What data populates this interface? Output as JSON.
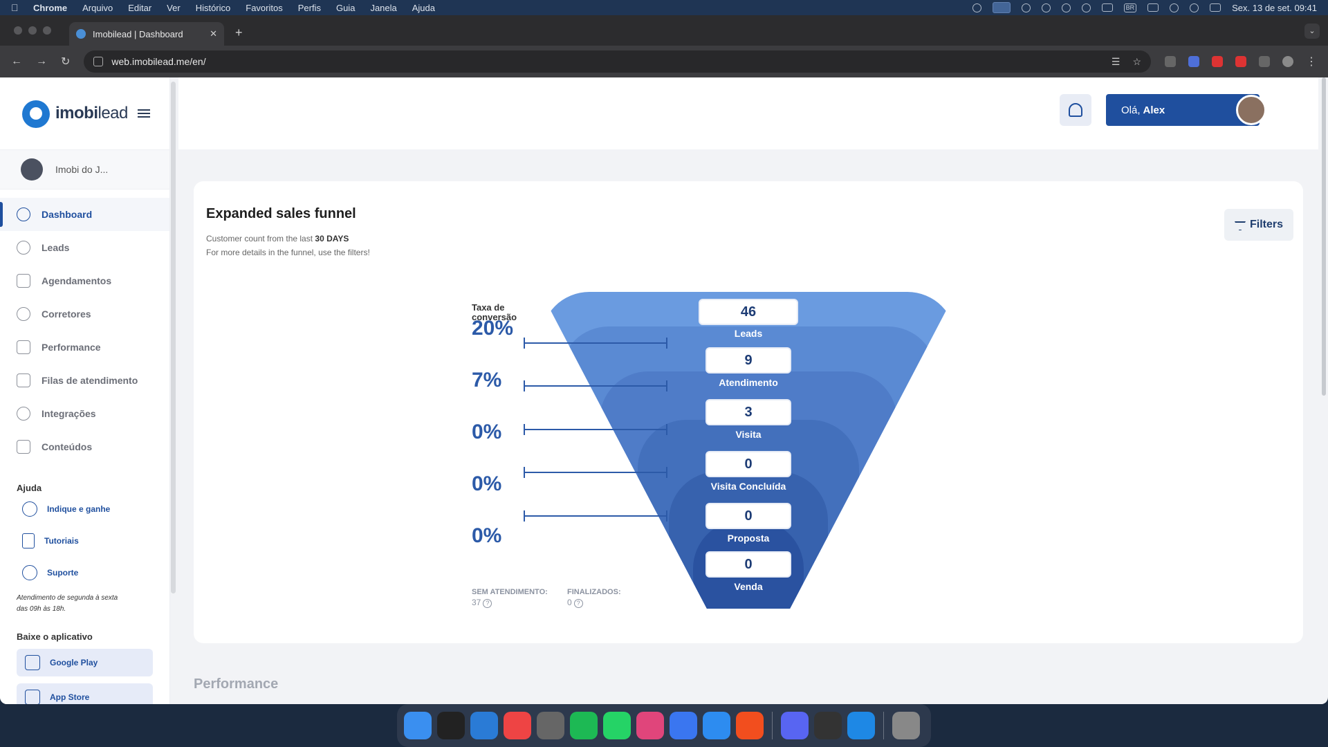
{
  "menubar": {
    "items": [
      "Chrome",
      "Arquivo",
      "Editar",
      "Ver",
      "Histórico",
      "Favoritos",
      "Perfis",
      "Guia",
      "Janela",
      "Ajuda"
    ],
    "keyboard_indicator": "BR",
    "clock": "Sex. 13 de set.  09:41"
  },
  "browser": {
    "tab_title": "Imobilead | Dashboard",
    "url": "web.imobilead.me/en/"
  },
  "sidebar": {
    "logo_bold": "imobi",
    "logo_light": "lead",
    "org_name": "Imobi do J...",
    "nav": [
      {
        "label": "Dashboard",
        "icon": "dashboard-icon",
        "active": true
      },
      {
        "label": "Leads",
        "icon": "user-icon"
      },
      {
        "label": "Agendamentos",
        "icon": "calendar-icon"
      },
      {
        "label": "Corretores",
        "icon": "team-icon"
      },
      {
        "label": "Performance",
        "icon": "chart-line-icon"
      },
      {
        "label": "Filas de atendimento",
        "icon": "queue-icon"
      },
      {
        "label": "Integrações",
        "icon": "bolt-icon"
      },
      {
        "label": "Conteúdos",
        "icon": "grid-icon"
      }
    ],
    "help_title": "Ajuda",
    "help": [
      {
        "label": "Indique e ganhe",
        "icon": "dollar-icon"
      },
      {
        "label": "Tutoriais",
        "icon": "book-icon"
      },
      {
        "label": "Suporte",
        "icon": "whatsapp-icon"
      }
    ],
    "support_note": "Atendimento de segunda à sexta das 09h às 18h.",
    "app_title": "Baixe o aplicativo",
    "stores": [
      {
        "label": "Google Play",
        "icon": "android-icon"
      },
      {
        "label": "App Store",
        "icon": "apple-icon"
      }
    ]
  },
  "header": {
    "greeting": "Olá,",
    "user_name": "Alex"
  },
  "card": {
    "title": "Expanded sales funnel",
    "subtitle_prefix": "Customer count from the last",
    "subtitle_period": "30 DAYS",
    "subtitle_line2": "For more details in the funnel, use the filters!",
    "filters_label": "Filters"
  },
  "funnel": {
    "rate_heading_line1": "Taxa de",
    "rate_heading_line2": "conversão",
    "stages": [
      {
        "label": "Leads",
        "count": "46"
      },
      {
        "label": "Atendimento",
        "count": "9"
      },
      {
        "label": "Visita",
        "count": "3"
      },
      {
        "label": "Visita Concluída",
        "count": "0"
      },
      {
        "label": "Proposta",
        "count": "0"
      },
      {
        "label": "Venda",
        "count": "0"
      }
    ],
    "rates": [
      "20%",
      "7%",
      "0%",
      "0%",
      "0%"
    ],
    "sem_atendimento_label": "SEM ATENDIMENTO:",
    "sem_atendimento_value": "37",
    "finalizados_label": "FINALIZADOS:",
    "finalizados_value": "0",
    "colors": [
      "#6a9be0",
      "#5a8ad3",
      "#4f7cc8",
      "#4370bc",
      "#3762ae",
      "#2a52a0"
    ]
  },
  "performance_heading": "Performance",
  "dock": {
    "apps": [
      "finder-icon",
      "terminal-icon",
      "vscode-icon",
      "chrome-icon",
      "calculator-icon",
      "spotify-icon",
      "whatsapp-icon",
      "slack-icon",
      "signal-icon",
      "appstore-icon",
      "figma-icon",
      "discord-icon",
      "obs-icon",
      "quicktime-icon",
      "trash-icon"
    ]
  }
}
